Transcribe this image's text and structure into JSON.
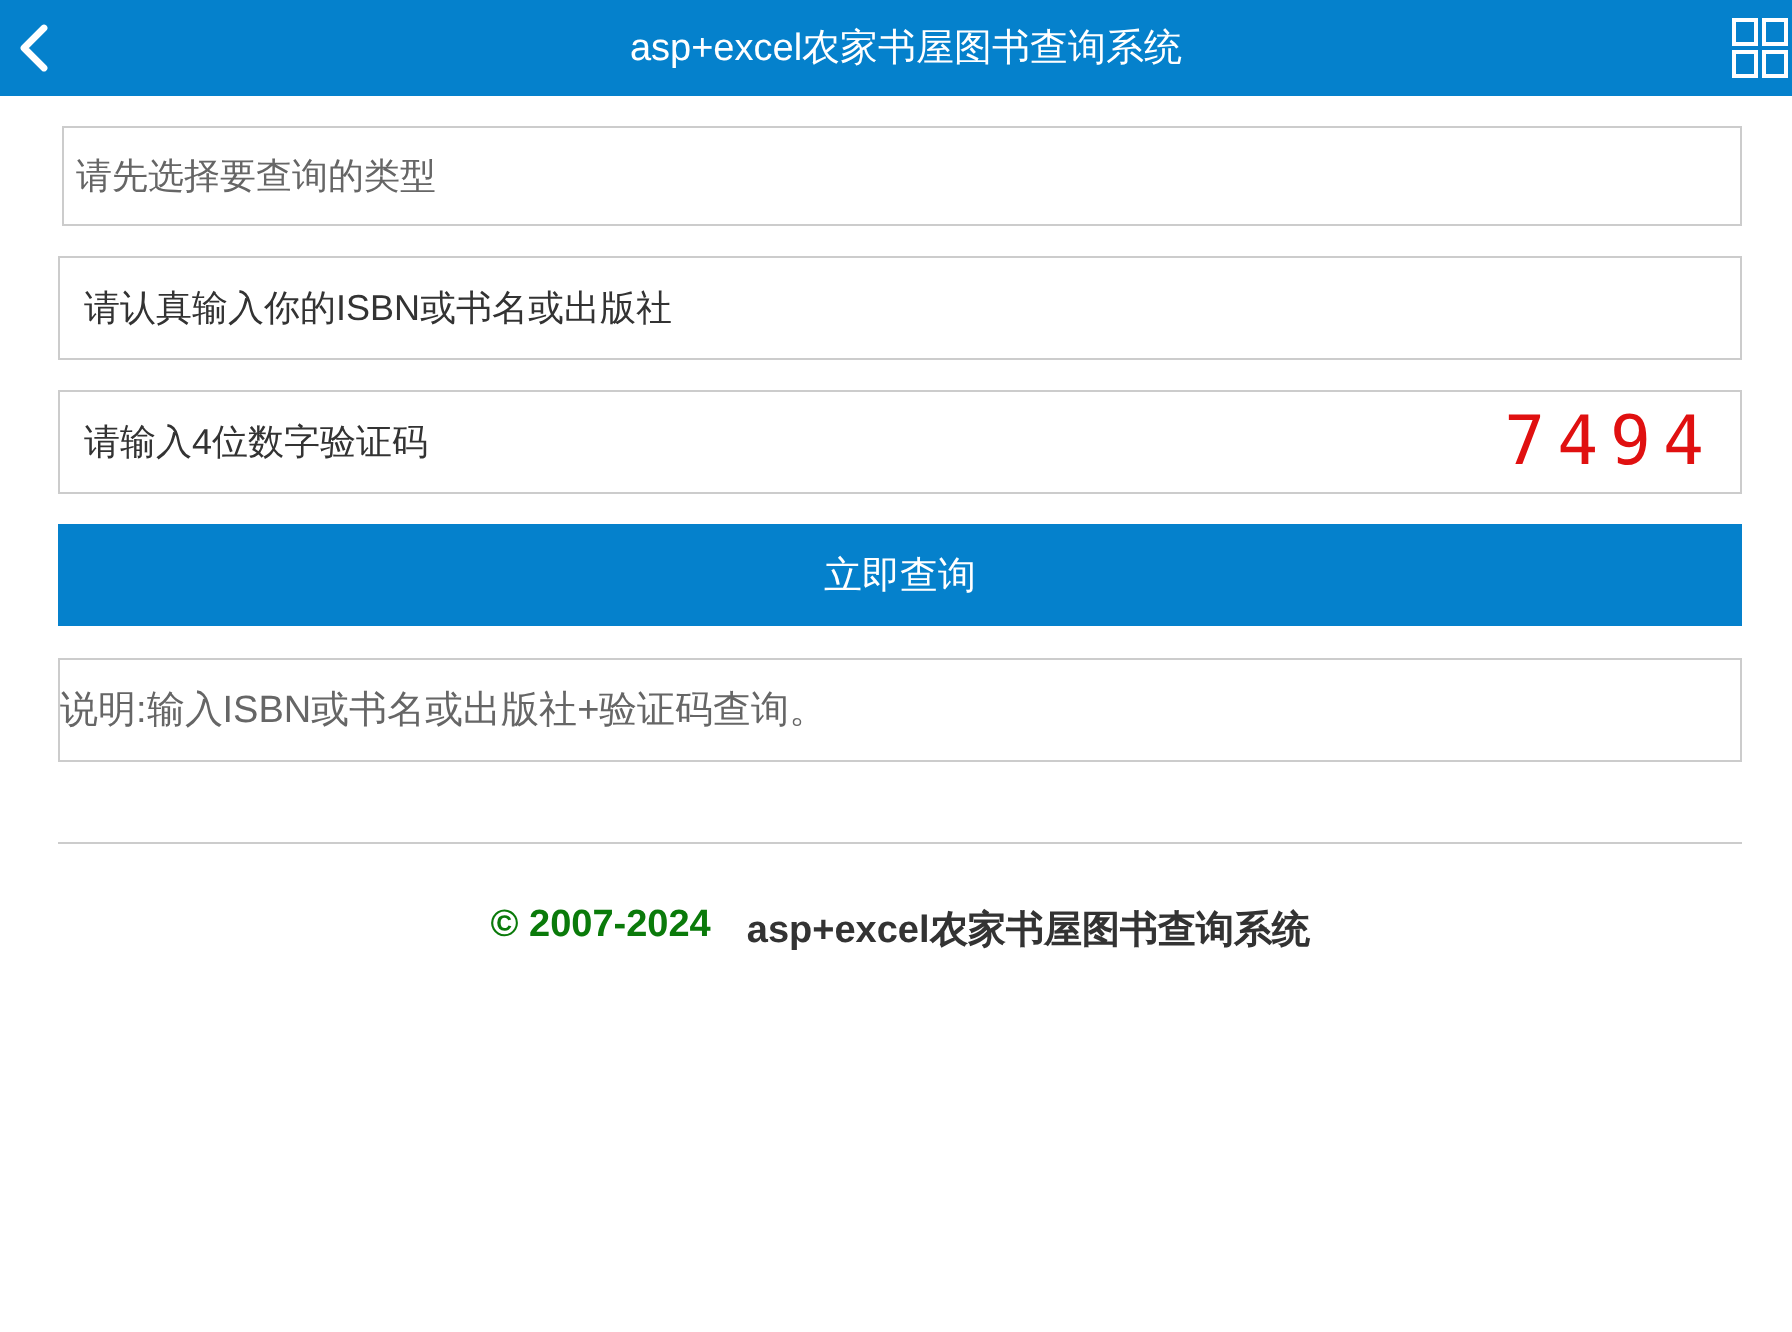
{
  "header": {
    "title": "asp+excel农家书屋图书查询系统"
  },
  "form": {
    "type_select": {
      "value": "请先选择要查询的类型"
    },
    "keyword_field": {
      "placeholder": "请认真输入你的ISBN或书名或出版社"
    },
    "captcha_field": {
      "placeholder": "请输入4位数字验证码",
      "captcha": "7494"
    },
    "submit_button": "立即查询",
    "note": "说明:输入ISBN或书名或出版社+验证码查询。"
  },
  "footer": {
    "copyright": "© 2007-2024",
    "site_name": "asp+excel农家书屋图书查询系统"
  }
}
